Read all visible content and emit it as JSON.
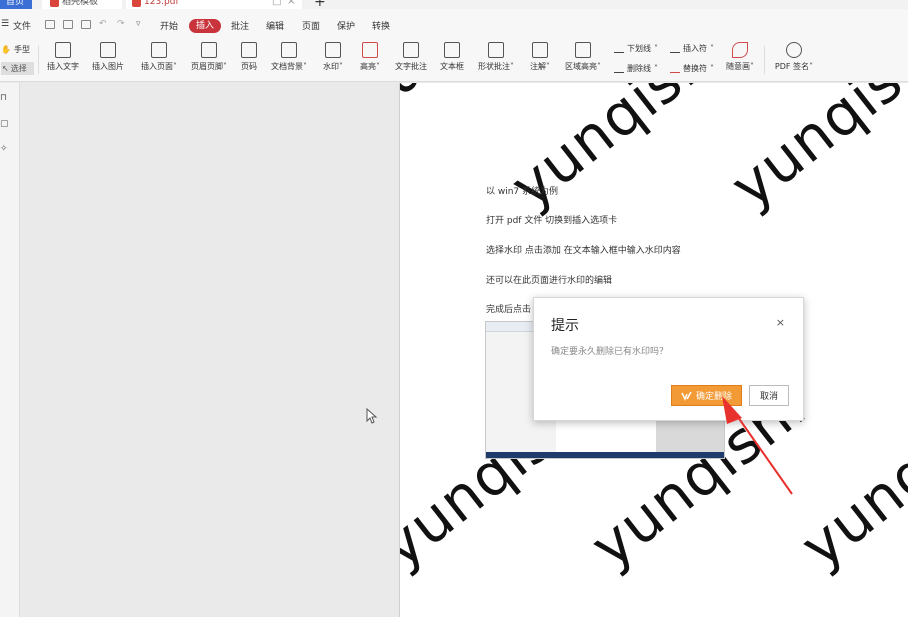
{
  "tabs": {
    "home": "首页",
    "template": "稻壳模板",
    "pdf": "123.pdf",
    "add": "+"
  },
  "menu": {
    "file": "文件",
    "start": "开始",
    "insert": "插入",
    "comment": "批注",
    "edit": "编辑",
    "page": "页面",
    "protect": "保护",
    "convert": "转换"
  },
  "ribbon": {
    "hand": "手型",
    "select": "选择",
    "insert_text": "插入文字",
    "insert_image": "插入图片",
    "insert_page": "插入页面",
    "header_footer": "页眉页脚",
    "page_number": "页码",
    "doc_background": "文档背景",
    "watermark": "水印",
    "highlight": "高亮",
    "text_comment": "文字批注",
    "text_box": "文本框",
    "shape_comment": "形状批注",
    "annotation": "注解",
    "area_highlight": "区域高亮",
    "underline": "下划线",
    "strikethrough": "删除线",
    "insert_mark": "插入符",
    "replace_mark": "替换符",
    "freehand": "随意画",
    "pdf_sign": "PDF 签名"
  },
  "document": {
    "lines": [
      "以 win7 系统为例",
      "打开 pdf 文件    切换到插入选项卡",
      "选择水印     点击添加    在文本输入框中输入水印内容",
      "还可以在此页面进行水印的编辑",
      "完成后点击"
    ],
    "watermark_text": "yunqishi"
  },
  "dialog": {
    "title": "提示",
    "close": "×",
    "message": "确定要永久删除已有水印吗？",
    "confirm": "确定删除",
    "cancel": "取消"
  },
  "colors": {
    "accent_red": "#c9343c",
    "confirm_orange": "#f19a36",
    "arrow_red": "#e8302c"
  }
}
